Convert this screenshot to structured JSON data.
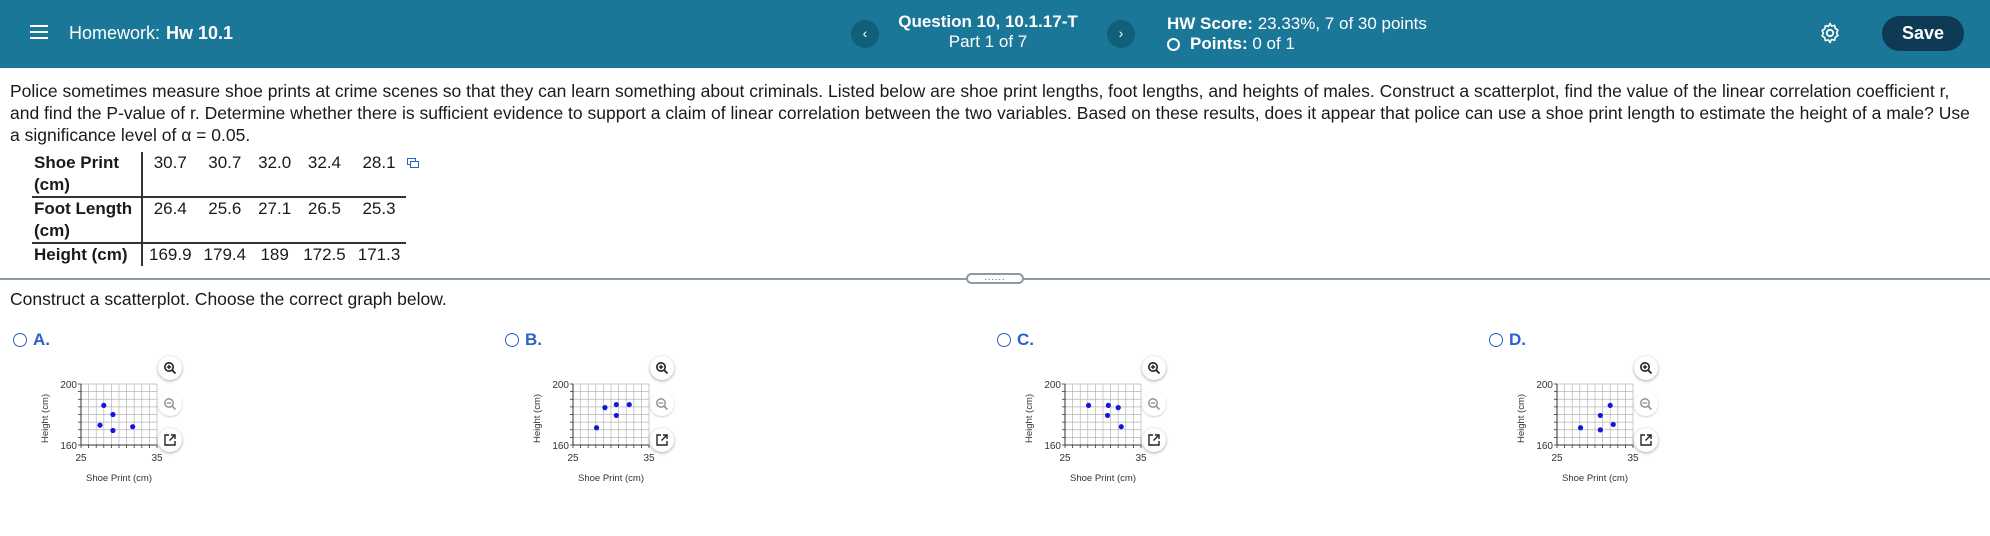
{
  "header": {
    "homework_label": "Homework:",
    "homework_name": "Hw 10.1",
    "question_title": "Question 10, 10.1.17-T",
    "question_part": "Part 1 of 7",
    "prev_label": "‹",
    "next_label": "›",
    "score_label": "HW Score:",
    "score_value": "23.33%, 7 of 30 points",
    "points_label": "Points:",
    "points_value": "0 of 1",
    "save_label": "Save",
    "bg_color": "#1b7797"
  },
  "question": {
    "text": "Police sometimes measure shoe prints at crime scenes so that they can learn something about criminals. Listed below are shoe print lengths, foot lengths, and heights of males. Construct a scatterplot, find the value of the linear correlation coefficient r, and find the P-value of r. Determine whether there is sufficient evidence to support a claim of linear correlation between the two variables. Based on these results, does it appear that police can use a shoe print length to estimate the height of a male? Use a significance level of α = 0.05."
  },
  "table": {
    "rows": [
      {
        "header_line1": "Shoe Print",
        "header_line2": "(cm)",
        "values": [
          "30.7",
          "30.7",
          "32.0",
          "32.4",
          "28.1"
        ]
      },
      {
        "header_line1": "Foot Length",
        "header_line2": "(cm)",
        "values": [
          "26.4",
          "25.6",
          "27.1",
          "26.5",
          "25.3"
        ]
      },
      {
        "header_line1": "Height (cm)",
        "header_line2": "",
        "values": [
          "169.9",
          "179.4",
          "189",
          "172.5",
          "171.3"
        ]
      }
    ]
  },
  "grip_label": "......",
  "prompt": "Construct a scatterplot. Choose the correct graph below.",
  "options": [
    {
      "letter": "A.",
      "ytop": "200",
      "ybot": "160",
      "xleft": "25",
      "xright": "35",
      "xlabel": "Shoe Print (cm)",
      "ylabel": "Height (cm)"
    },
    {
      "letter": "B.",
      "ytop": "200",
      "ybot": "160",
      "xleft": "25",
      "xright": "35",
      "xlabel": "Shoe Print (cm)",
      "ylabel": "Height (cm)"
    },
    {
      "letter": "C.",
      "ytop": "200",
      "ybot": "160",
      "xleft": "25",
      "xright": "35",
      "xlabel": "Shoe Print (cm)",
      "ylabel": "Height (cm)"
    },
    {
      "letter": "D.",
      "ytop": "200",
      "ybot": "160",
      "xleft": "25",
      "xright": "35",
      "xlabel": "Shoe Print (cm)",
      "ylabel": "Height (cm)"
    }
  ],
  "chart_data": [
    {
      "type": "scatter",
      "xlabel": "Shoe Print (cm)",
      "ylabel": "Height (cm)",
      "xlim": [
        25,
        35
      ],
      "ylim": [
        160,
        200
      ],
      "points": [
        [
          28.0,
          186.0
        ],
        [
          29.2,
          180.0
        ],
        [
          27.5,
          173.0
        ],
        [
          29.2,
          169.5
        ],
        [
          31.8,
          172.0
        ]
      ]
    },
    {
      "type": "scatter",
      "xlabel": "Shoe Print (cm)",
      "ylabel": "Height (cm)",
      "xlim": [
        25,
        35
      ],
      "ylim": [
        160,
        200
      ],
      "points": [
        [
          28.1,
          171.3
        ],
        [
          30.7,
          179.4
        ],
        [
          32.4,
          186.5
        ],
        [
          30.7,
          186.5
        ],
        [
          29.2,
          184.5
        ]
      ]
    },
    {
      "type": "scatter",
      "xlabel": "Shoe Print (cm)",
      "ylabel": "Height (cm)",
      "xlim": [
        25,
        35
      ],
      "ylim": [
        160,
        200
      ],
      "points": [
        [
          28.1,
          186.0
        ],
        [
          30.7,
          186.0
        ],
        [
          32.0,
          184.5
        ],
        [
          30.6,
          179.4
        ],
        [
          32.4,
          172.0
        ]
      ]
    },
    {
      "type": "scatter",
      "xlabel": "Shoe Print (cm)",
      "ylabel": "Height (cm)",
      "xlim": [
        25,
        35
      ],
      "ylim": [
        160,
        200
      ],
      "points": [
        [
          32.0,
          186.0
        ],
        [
          30.7,
          179.4
        ],
        [
          32.4,
          173.5
        ],
        [
          28.1,
          171.3
        ],
        [
          30.7,
          169.9
        ]
      ]
    }
  ],
  "colors": {
    "accent": "#2a62c9",
    "point": "#1515e0",
    "save": "#0e3a55"
  },
  "icons": [
    "menu-icon",
    "settings-gear-icon",
    "zoom-in-icon",
    "zoom-out-icon",
    "expand-icon",
    "copy-icon"
  ]
}
